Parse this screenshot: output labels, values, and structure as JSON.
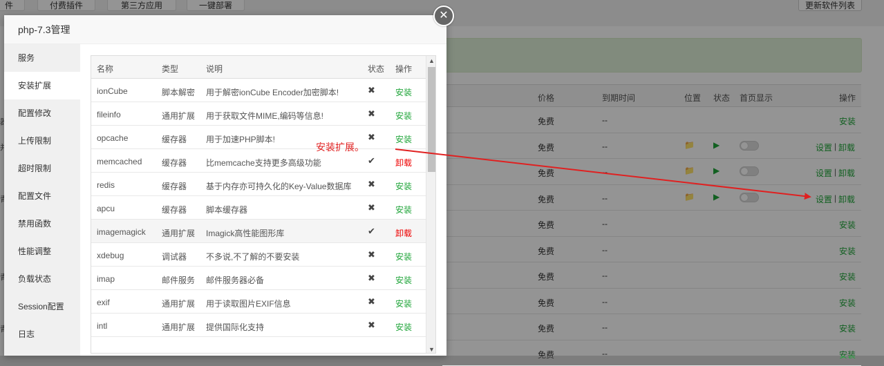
{
  "background": {
    "top_tabs": [
      "付费插件",
      "第三方应用",
      "一键部署"
    ],
    "top_tab_left_partial": "件",
    "update_button": "更新软件列表",
    "table_headers": {
      "price": "价格",
      "expire": "到期时间",
      "location": "位置",
      "status": "状态",
      "homepage": "首页显示",
      "action": "操作"
    },
    "rows": [
      {
        "price": "免费",
        "expire": "--",
        "action": "安装",
        "has_controls": false
      },
      {
        "price": "免费",
        "expire": "--",
        "action_set": "设置",
        "sep": "|",
        "action_del": "卸载",
        "has_controls": true
      },
      {
        "price": "免费",
        "expire": "--",
        "action_set": "设置",
        "sep": "|",
        "action_del": "卸载",
        "has_controls": true
      },
      {
        "price": "免费",
        "expire": "--",
        "action_set": "设置",
        "sep": "|",
        "action_del": "卸载",
        "has_controls": true
      },
      {
        "price": "免费",
        "expire": "--",
        "action": "安装",
        "has_controls": false
      },
      {
        "price": "免费",
        "expire": "--",
        "action": "安装",
        "has_controls": false
      },
      {
        "price": "免费",
        "expire": "--",
        "action": "安装",
        "has_controls": false
      },
      {
        "price": "免费",
        "expire": "--",
        "action": "安装",
        "has_controls": false
      },
      {
        "price": "免费",
        "expire": "--",
        "action": "安装",
        "has_controls": false
      },
      {
        "price": "免费",
        "expire": "--",
        "action": "安装",
        "has_controls": false
      }
    ]
  },
  "modal": {
    "title": "php-7.3管理",
    "close_icon": "close-icon",
    "sidebar": [
      {
        "label": "服务"
      },
      {
        "label": "安装扩展",
        "active": true
      },
      {
        "label": "配置修改"
      },
      {
        "label": "上传限制"
      },
      {
        "label": "超时限制"
      },
      {
        "label": "配置文件"
      },
      {
        "label": "禁用函数"
      },
      {
        "label": "性能调整"
      },
      {
        "label": "负载状态"
      },
      {
        "label": "Session配置"
      },
      {
        "label": "日志"
      }
    ],
    "ext_table": {
      "headers": {
        "name": "名称",
        "type": "类型",
        "desc": "说明",
        "status": "状态",
        "op": "操作"
      },
      "rows": [
        {
          "name": "ionCube",
          "type": "脚本解密",
          "desc": "用于解密ionCube Encoder加密脚本!",
          "status": "✖",
          "op": "安装",
          "installed": false
        },
        {
          "name": "fileinfo",
          "type": "通用扩展",
          "desc": "用于获取文件MIME,编码等信息!",
          "status": "✖",
          "op": "安装",
          "installed": false
        },
        {
          "name": "opcache",
          "type": "缓存器",
          "desc": "用于加速PHP脚本!",
          "status": "✖",
          "op": "安装",
          "installed": false
        },
        {
          "name": "memcached",
          "type": "缓存器",
          "desc": "比memcache支持更多高级功能",
          "status": "✔",
          "op": "卸载",
          "installed": true
        },
        {
          "name": "redis",
          "type": "缓存器",
          "desc": "基于内存亦可持久化的Key-Value数据库",
          "status": "✖",
          "op": "安装",
          "installed": false
        },
        {
          "name": "apcu",
          "type": "缓存器",
          "desc": "脚本缓存器",
          "status": "✖",
          "op": "安装",
          "installed": false
        },
        {
          "name": "imagemagick",
          "type": "通用扩展",
          "desc": "Imagick高性能图形库",
          "status": "✔",
          "op": "卸载",
          "installed": true,
          "highlight": true
        },
        {
          "name": "xdebug",
          "type": "调试器",
          "desc": "不多说,不了解的不要安装",
          "status": "✖",
          "op": "安装",
          "installed": false
        },
        {
          "name": "imap",
          "type": "邮件服务",
          "desc": "邮件服务器必备",
          "status": "✖",
          "op": "安装",
          "installed": false
        },
        {
          "name": "exif",
          "type": "通用扩展",
          "desc": "用于读取图片EXIF信息",
          "status": "✖",
          "op": "安装",
          "installed": false
        },
        {
          "name": "intl",
          "type": "通用扩展",
          "desc": "提供国际化支持",
          "status": "✖",
          "op": "安装",
          "installed": false
        }
      ]
    }
  },
  "annotation": {
    "text": "安装扩展。",
    "color": "#e02020"
  },
  "colors": {
    "accent_green": "#20a53a",
    "uninstall_red": "#ee0000",
    "folder_yellow": "#e6a700"
  }
}
